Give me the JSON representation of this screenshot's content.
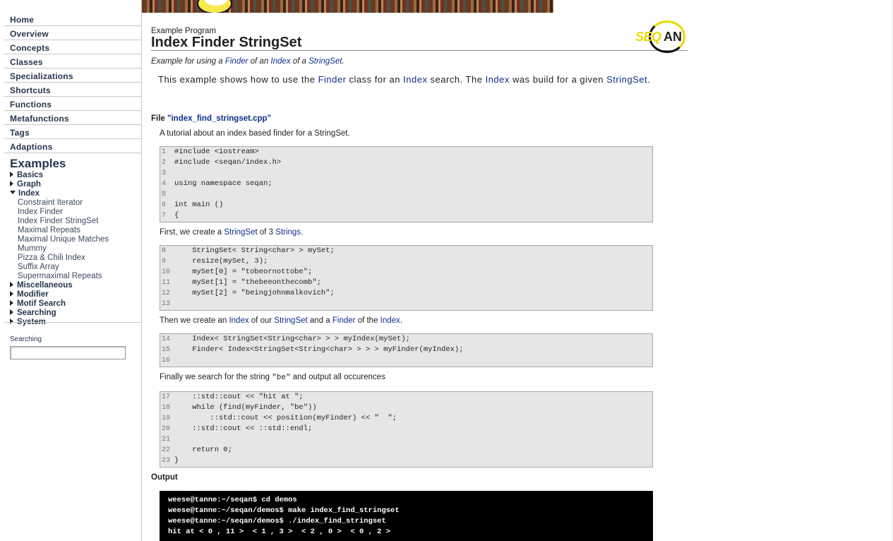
{
  "sidebar": {
    "nav": [
      "Home",
      "Overview",
      "Concepts",
      "Classes",
      "Specializations",
      "Shortcuts",
      "Functions",
      "Metafunctions",
      "Tags",
      "Adaptions"
    ],
    "examples_title": "Examples",
    "categories": [
      {
        "label": "Basics",
        "expanded": false
      },
      {
        "label": "Graph",
        "expanded": false
      },
      {
        "label": "Index",
        "expanded": true,
        "items": [
          "Constraint Iterator",
          "Index Finder",
          "Index Finder StringSet",
          "Maximal Repeats",
          "Maximal Unique Matches",
          "Mummy",
          "Pizza & Chili Index",
          "Suffix Array",
          "Supermaximal Repeats"
        ]
      },
      {
        "label": "Miscellaneous",
        "expanded": false
      },
      {
        "label": "Modifier",
        "expanded": false
      },
      {
        "label": "Motif Search",
        "expanded": false
      },
      {
        "label": "Searching",
        "expanded": false
      },
      {
        "label": "System",
        "expanded": false
      }
    ],
    "search_label": "Searching",
    "search_value": ""
  },
  "header": {
    "kicker": "Example Program",
    "title": "Index Finder StringSet",
    "logo_text_1": "SEQ",
    "logo_text_2": "AN"
  },
  "subtitle": {
    "pre": "Example for using a ",
    "link1": "Finder",
    "mid1": " of an ",
    "link2": "Index",
    "mid2": " of a ",
    "link3": "StringSet",
    "post": "."
  },
  "intro": {
    "t1": "This example shows how to use the ",
    "l1": "Finder",
    "t2": " class for an ",
    "l2": "Index",
    "t3": " search. The ",
    "l3": "Index",
    "t4": " was build for a given ",
    "l4": "StringSet",
    "t5": "."
  },
  "file": {
    "prefix": "File ",
    "name": "\"index_find_stringset.cpp\""
  },
  "para1": "A tutorial about an index based finder for a StringSet.",
  "para2": {
    "t1": "First, we create a ",
    "l1": "StringSet",
    "t2": " of 3 ",
    "l2": "Strings",
    "t3": "."
  },
  "para3": {
    "t1": "Then we create an ",
    "l1": "Index",
    "t2": " of our ",
    "l2": "StringSet",
    "t3": " and a ",
    "l3": "Finder",
    "t4": " of the ",
    "l4": "Index",
    "t5": "."
  },
  "para4": {
    "t1": "Finally we search for the string ",
    "code": "\"be\"",
    "t2": " and output all occurences"
  },
  "code_blocks": [
    {
      "lines": [
        [
          "1",
          "#include <iostream>"
        ],
        [
          "2",
          "#include <seqan/index.h>"
        ],
        [
          "3",
          ""
        ],
        [
          "4",
          "using namespace seqan;"
        ],
        [
          "5",
          ""
        ],
        [
          "6",
          "int main ()"
        ],
        [
          "7",
          "{"
        ]
      ]
    },
    {
      "lines": [
        [
          "8",
          "    StringSet< String<char> > mySet;"
        ],
        [
          "9",
          "    resize(mySet, 3);"
        ],
        [
          "10",
          "    mySet[0] = \"tobeornottobe\";"
        ],
        [
          "11",
          "    mySet[1] = \"thebeeonthecomb\";"
        ],
        [
          "12",
          "    mySet[2] = \"beingjohnmalkovich\";"
        ],
        [
          "13",
          ""
        ]
      ]
    },
    {
      "lines": [
        [
          "14",
          "    Index< StringSet<String<char> > > myIndex(mySet);"
        ],
        [
          "15",
          "    Finder< Index<StringSet<String<char> > > > myFinder(myIndex);"
        ],
        [
          "16",
          ""
        ]
      ]
    },
    {
      "lines": [
        [
          "17",
          "    ::std::cout << \"hit at \";"
        ],
        [
          "18",
          "    while (find(myFinder, \"be\"))"
        ],
        [
          "19",
          "        ::std::cout << position(myFinder) << \"  \";"
        ],
        [
          "20",
          "    ::std::cout << ::std::endl;"
        ],
        [
          "21",
          ""
        ],
        [
          "22",
          "    return 0;"
        ],
        [
          "23",
          "}"
        ]
      ]
    }
  ],
  "output_title": "Output",
  "terminal": [
    "weese@tanne:~/seqan$ cd demos",
    "weese@tanne:~/seqan/demos$ make index_find_stringset",
    "weese@tanne:~/seqan/demos$ ./index_find_stringset",
    "hit at < 0 , 11 >  < 1 , 3 >  < 2 , 0 >  < 0 , 2 >"
  ]
}
